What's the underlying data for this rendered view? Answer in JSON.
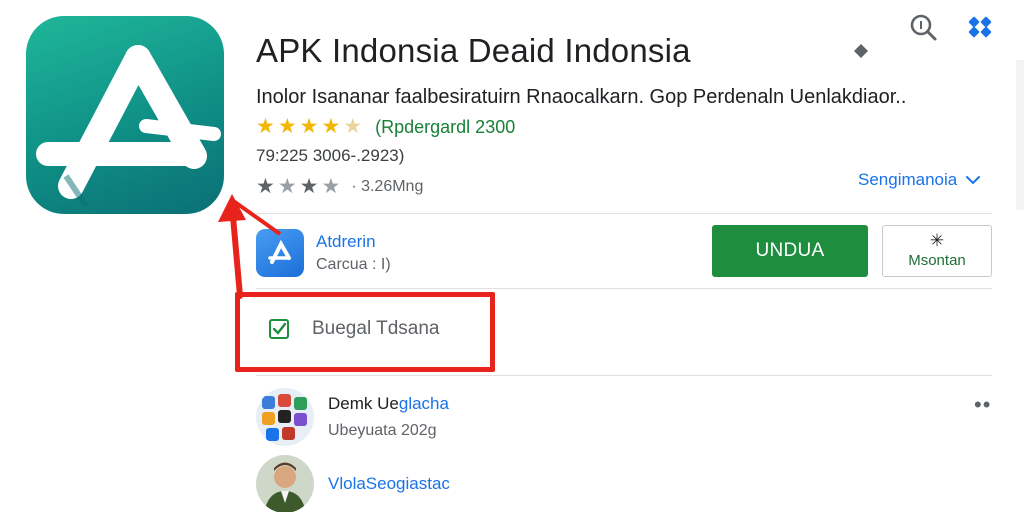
{
  "app": {
    "title": "APK Indonsia Deaid Indonsia",
    "subtitle": "Inolor Isananar faalbesiratuirn Rnaocalkarn. Gop Perdenaln Uenlakdiaor..",
    "rating_text": "(Rpdergardl 2300",
    "info_line": "79:225 3006-.2923)",
    "size_text": "· 3.26Mng",
    "more_link": "Sengimanoia",
    "stars_top": {
      "filled": 4,
      "total": 5
    },
    "stars_bottom": {
      "filled": 3,
      "total": 5
    }
  },
  "developer": {
    "name": "Atdrerin",
    "sub": "Carcua : I)"
  },
  "actions": {
    "install_label": "UNDUA",
    "wishlist_icon": "✳",
    "wishlist_label": "Msontan"
  },
  "highlight": {
    "checkbox_label": "Buegal Tdsana"
  },
  "reviews": [
    {
      "name_main": "Demk Ue",
      "name_accent": "glacha",
      "sub": "Ubeyuata 202g"
    },
    {
      "name_main": "",
      "name_accent": "VlolaSeogiastac",
      "sub": ""
    }
  ],
  "colors": {
    "brand": "#0f8f86",
    "install": "#1e8e3e",
    "link": "#1a73e8",
    "highlight": "#e8231c",
    "star": "#f2b705"
  },
  "icons": {
    "search": "search-icon",
    "grid": "grid-icon",
    "diamond": "diamond-icon",
    "chevron": "chevron-down-icon",
    "check": "checkbox-icon",
    "more": "more-dots-icon"
  }
}
